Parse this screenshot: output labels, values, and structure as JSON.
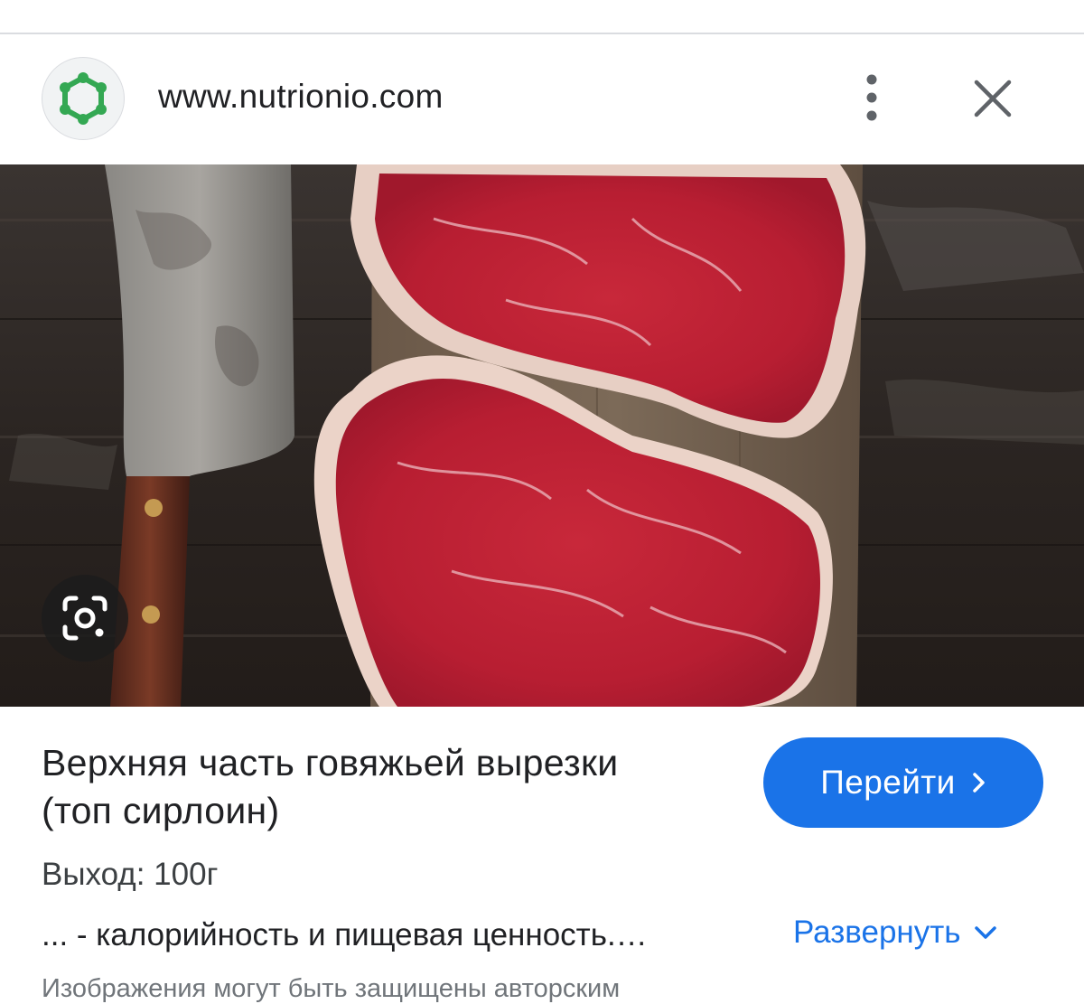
{
  "header": {
    "site_url": "www.nutrionio.com",
    "favicon": "nutrionio-logo",
    "more_icon": "more-vert-icon",
    "close_icon": "close-icon"
  },
  "image": {
    "alt": "Raw beef steaks on wooden board with cleaver",
    "lens_icon": "google-lens-icon"
  },
  "result": {
    "title_line1": "Верхняя часть говяжьей вырезки",
    "title_line2": "(топ сирлоин)",
    "yield": "Выход: 100г",
    "snippet": "... - калорийность и пищевая ценность.…",
    "copyright": "Изображения могут быть защищены авторским"
  },
  "actions": {
    "go_label": "Перейти",
    "expand_label": "Развернуть"
  },
  "colors": {
    "accent": "#1a73e8",
    "favicon_green": "#34a853"
  }
}
